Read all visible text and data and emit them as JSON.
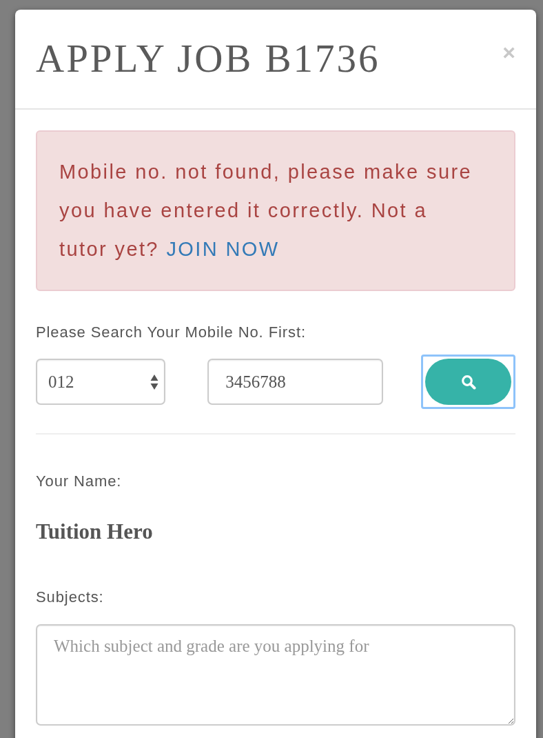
{
  "dialog": {
    "title": "APPLY JOB B1736",
    "close": "×"
  },
  "alert": {
    "text": "Mobile no. not found, please make sure you have entered it correctly. Not a tutor yet?",
    "link": "JOIN NOW"
  },
  "search": {
    "label": "Please Search Your Mobile No. First:",
    "prefix": {
      "value": "012"
    },
    "number": {
      "value": "3456788"
    },
    "button": {
      "focused": true
    }
  },
  "name": {
    "label": "Your Name:",
    "value": "Tuition Hero"
  },
  "subjects": {
    "label": "Subjects:",
    "placeholder": "Which subject and grade are you applying for"
  }
}
